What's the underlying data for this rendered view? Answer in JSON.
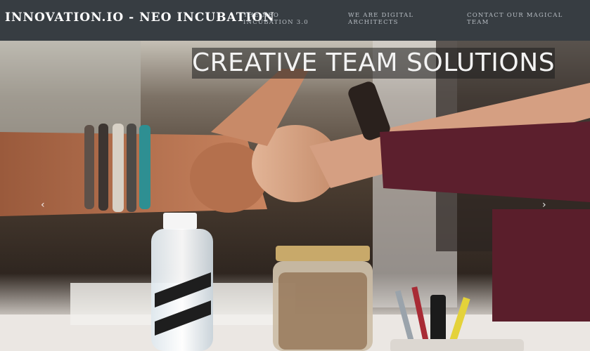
{
  "navbar": {
    "brand": "INNOVATION.IO - NEO INCUBATION",
    "links": [
      {
        "label": "THE NEO INCUBATION 3.0"
      },
      {
        "label": "WE ARE DIGITAL ARCHITECTS"
      },
      {
        "label": "CONTACT OUR MAGICAL TEAM"
      }
    ]
  },
  "carousel": {
    "caption": "CREATIVE TEAM SOLUTIONS",
    "prev_icon": "chevron-left-icon",
    "next_icon": "chevron-right-icon",
    "prev_glyph": "‹",
    "next_glyph": "›"
  },
  "colors": {
    "navbar_bg": "#373d42",
    "brand_text": "#ffffff",
    "link_text": "#b8bec4"
  }
}
